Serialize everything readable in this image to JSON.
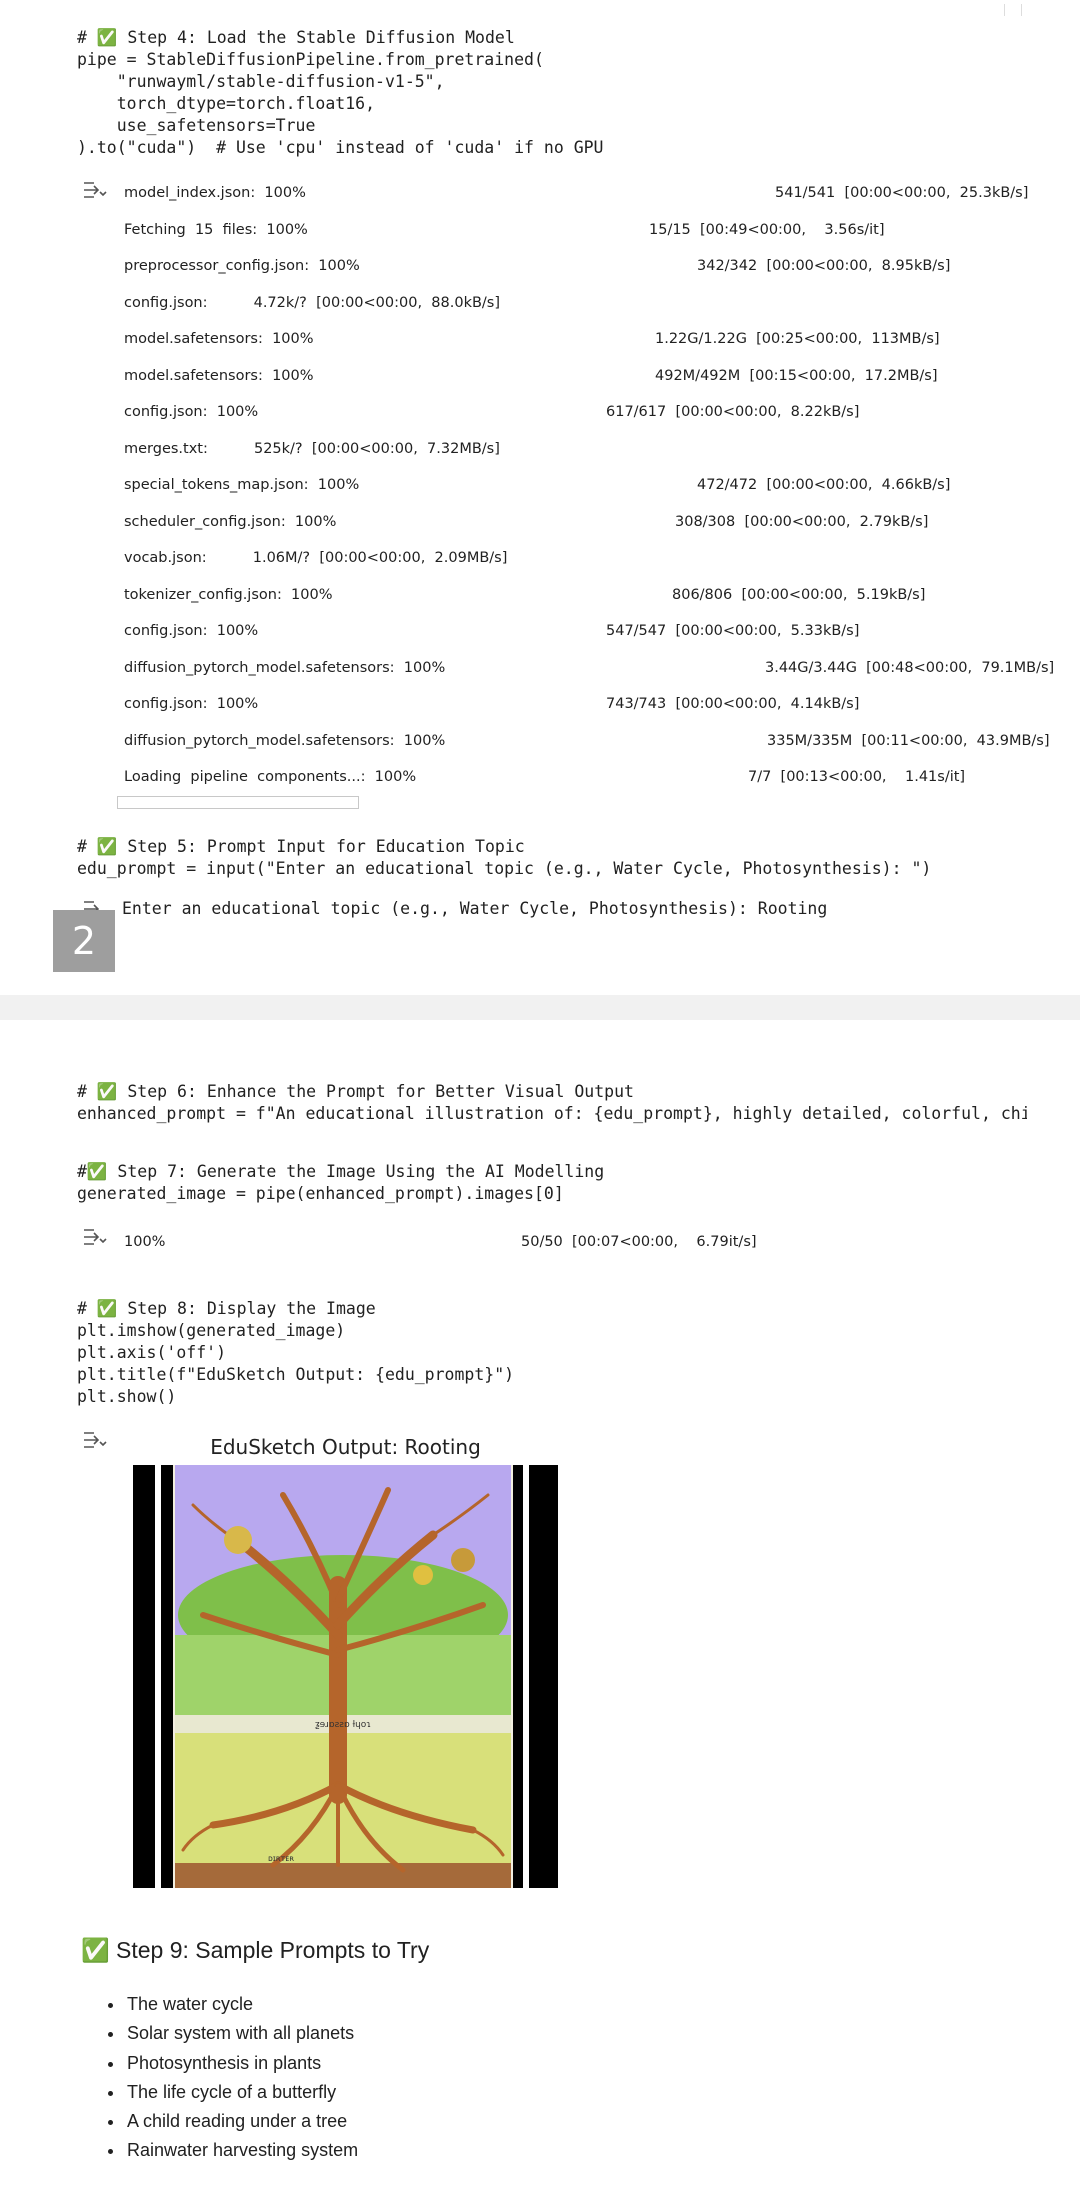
{
  "cell4": {
    "code": "# ✅ Step 4: Load the Stable Diffusion Model\npipe = StableDiffusionPipeline.from_pretrained(\n    \"runwayml/stable-diffusion-v1-5\",\n    torch_dtype=torch.float16,\n    use_safetensors=True\n).to(\"cuda\")  # Use 'cpu' instead of 'cuda' if no GPU",
    "progress": [
      {
        "label": "model_index.json:  100%",
        "stats": "541/541  [00:00<00:00,  25.3kB/s]",
        "percent": 100
      },
      {
        "label": "Fetching  15  files:  100%",
        "stats": "15/15  [00:49<00:00,    3.56s/it]",
        "percent": 100
      },
      {
        "label": "preprocessor_config.json:  100%",
        "stats": "342/342  [00:00<00:00,  8.95kB/s]",
        "percent": 100
      },
      {
        "label": "config.json:          4.72k/?  [00:00<00:00,  88.0kB/s]",
        "stats": "",
        "percent": null
      },
      {
        "label": "model.safetensors:  100%",
        "stats": "1.22G/1.22G  [00:25<00:00,  113MB/s]",
        "percent": 100
      },
      {
        "label": "model.safetensors:  100%",
        "stats": "492M/492M  [00:15<00:00,  17.2MB/s]",
        "percent": 100
      },
      {
        "label": "config.json:  100%",
        "stats": "617/617  [00:00<00:00,  8.22kB/s]",
        "percent": 100
      },
      {
        "label": "merges.txt:          525k/?  [00:00<00:00,  7.32MB/s]",
        "stats": "",
        "percent": null
      },
      {
        "label": "special_tokens_map.json:  100%",
        "stats": "472/472  [00:00<00:00,  4.66kB/s]",
        "percent": 100
      },
      {
        "label": "scheduler_config.json:  100%",
        "stats": "308/308  [00:00<00:00,  2.79kB/s]",
        "percent": 100
      },
      {
        "label": "vocab.json:          1.06M/?  [00:00<00:00,  2.09MB/s]",
        "stats": "",
        "percent": null
      },
      {
        "label": "tokenizer_config.json:  100%",
        "stats": "806/806  [00:00<00:00,  5.19kB/s]",
        "percent": 100
      },
      {
        "label": "config.json:  100%",
        "stats": "547/547  [00:00<00:00,  5.33kB/s]",
        "percent": 100
      },
      {
        "label": "diffusion_pytorch_model.safetensors:  100%",
        "stats": "3.44G/3.44G  [00:48<00:00,  79.1MB/s]",
        "percent": 100
      },
      {
        "label": "config.json:  100%",
        "stats": "743/743  [00:00<00:00,  4.14kB/s]",
        "percent": 100
      },
      {
        "label": "diffusion_pytorch_model.safetensors:  100%",
        "stats": "335M/335M  [00:11<00:00,  43.9MB/s]",
        "percent": 100
      },
      {
        "label": "Loading  pipeline  components...:  100%",
        "stats": "7/7  [00:13<00:00,    1.41s/it]",
        "percent": 100
      }
    ]
  },
  "cell5": {
    "code": "# ✅ Step 5: Prompt Input for Education Topic\nedu_prompt = input(\"Enter an educational topic (e.g., Water Cycle, Photosynthesis): \")",
    "output": "Enter an educational topic (e.g., Water Cycle, Photosynthesis): Rooting",
    "badge": "2"
  },
  "cell6": {
    "code": "# ✅ Step 6: Enhance the Prompt for Better Visual Output\nenhanced_prompt = f\"An educational illustration of: {edu_prompt}, highly detailed, colorful, child-f"
  },
  "cell7": {
    "code": "#✅ Step 7: Generate the Image Using the AI Modelling\ngenerated_image = pipe(enhanced_prompt).images[0]",
    "progress": {
      "label": "100%",
      "stats": "50/50  [00:07<00:00,    6.79it/s]",
      "percent": 100
    }
  },
  "cell8": {
    "code": "# ✅ Step 8: Display the Image\nplt.imshow(generated_image)\nplt.axis('off')\nplt.title(f\"EduSketch Output: {edu_prompt}\")\nplt.show()",
    "figure_title": "EduSketch Output: Rooting",
    "poster_caption": "ƺɘɹɒƨƨɒ ƚɥoɿ",
    "poster_footer": "ᴅɪʀᴛᴇʀ"
  },
  "step9": {
    "heading": "✅ Step 9: Sample Prompts to Try",
    "items": [
      "The water cycle",
      "Solar system with all planets",
      "Photosynthesis in plants",
      "The life cycle of a butterfly",
      "A child reading under a tree",
      "Rainwater harvesting system"
    ]
  },
  "colors": {
    "divider": "#f1f1f1",
    "badge": "#9e9e9e",
    "poster_sky": "#b8a8ef",
    "trunk": "#b5652b"
  }
}
